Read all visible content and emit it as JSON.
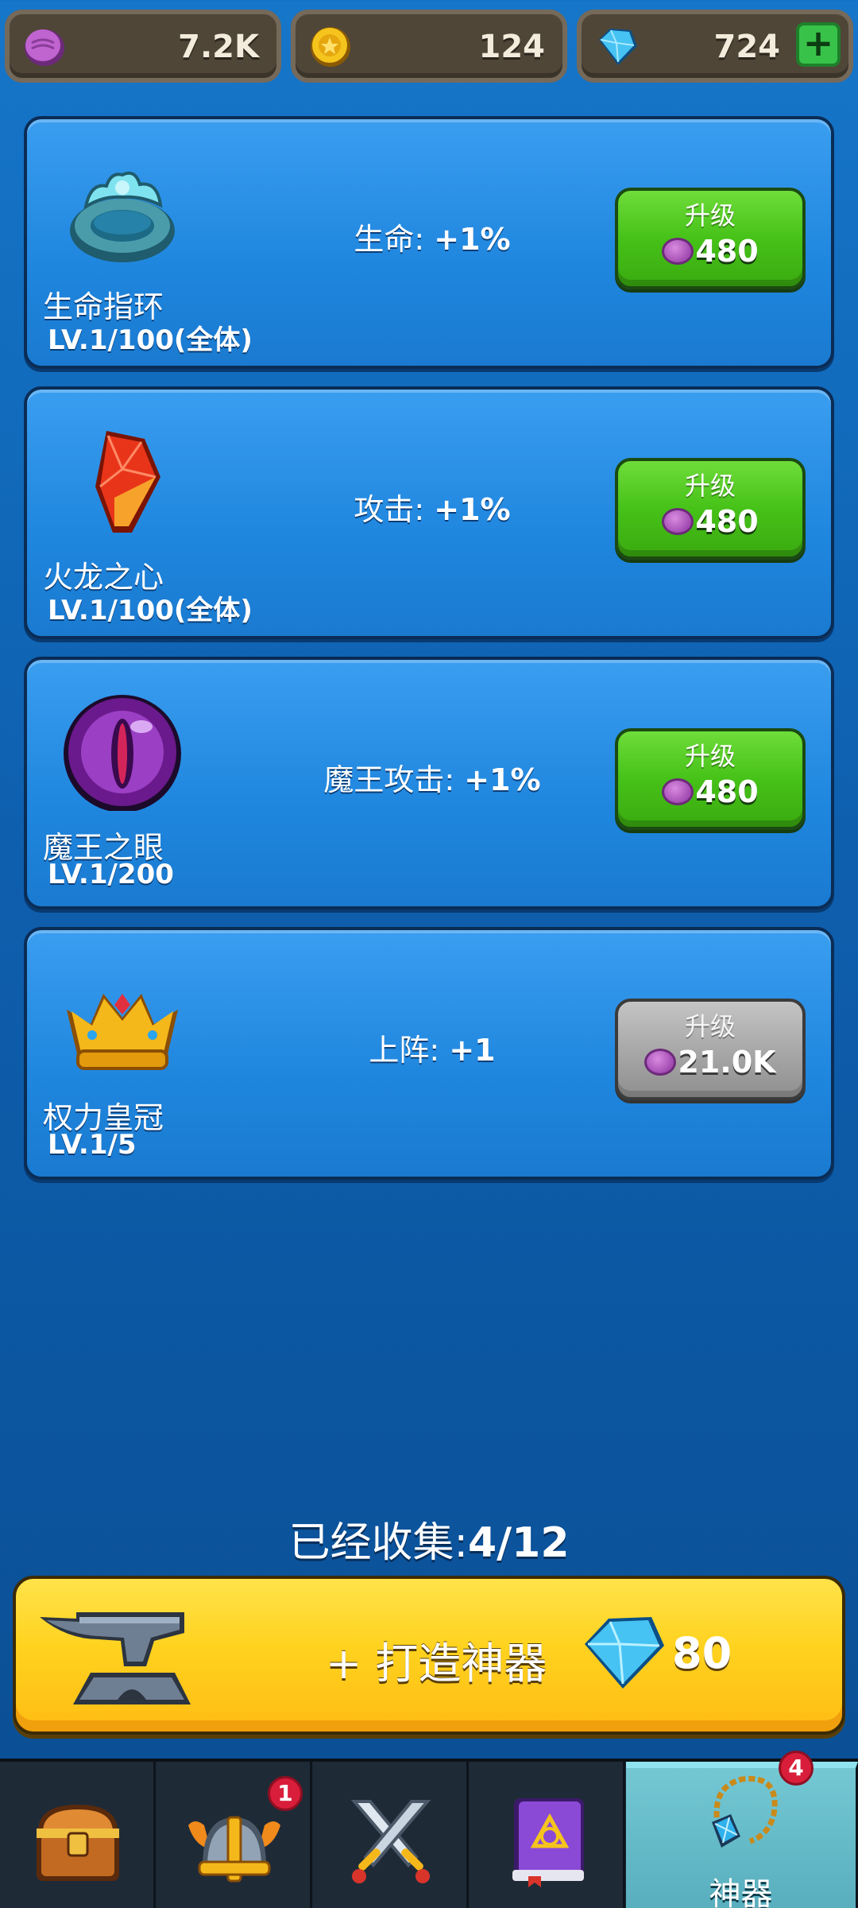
{
  "currencies": {
    "essence": {
      "icon": "purple-essence-icon",
      "value": "7.2K"
    },
    "gold": {
      "icon": "gold-coin-icon",
      "value": "124"
    },
    "gems": {
      "icon": "blue-gem-icon",
      "value": "724",
      "add_label": "+"
    }
  },
  "artifacts": [
    {
      "icon": "life-ring-icon",
      "name": "生命指环",
      "level": "LV.1/100(全体)",
      "effect_label": "生命:",
      "effect_value": "+1%",
      "upgrade_label": "升级",
      "cost": "480",
      "enabled": true
    },
    {
      "icon": "dragon-heart-icon",
      "name": "火龙之心",
      "level": "LV.1/100(全体)",
      "effect_label": "攻击:",
      "effect_value": "+1%",
      "upgrade_label": "升级",
      "cost": "480",
      "enabled": true
    },
    {
      "icon": "demon-eye-icon",
      "name": "魔王之眼",
      "level": "LV.1/200",
      "effect_label": "魔王攻击:",
      "effect_value": "+1%",
      "upgrade_label": "升级",
      "cost": "480",
      "enabled": true
    },
    {
      "icon": "crown-icon",
      "name": "权力皇冠",
      "level": "LV.1/5",
      "effect_label": "上阵:",
      "effect_value": "+1",
      "upgrade_label": "升级",
      "cost": "21.0K",
      "enabled": false
    }
  ],
  "collection": {
    "label": "已经收集:",
    "value": "4/12"
  },
  "forge": {
    "label": "+ 打造神器",
    "cost": "80",
    "icon": "anvil-icon",
    "cost_icon": "blue-gem-icon"
  },
  "nav": {
    "tabs": [
      {
        "icon": "treasure-chest-icon",
        "label": "",
        "badge": ""
      },
      {
        "icon": "viking-helmet-icon",
        "label": "",
        "badge": "1"
      },
      {
        "icon": "crossed-swords-icon",
        "label": "",
        "badge": ""
      },
      {
        "icon": "spell-book-icon",
        "label": "",
        "badge": ""
      },
      {
        "icon": "amulet-icon",
        "label": "神器",
        "badge": "4"
      }
    ]
  },
  "colors": {
    "upgrade_green": "#46c218",
    "upgrade_disabled": "#a6a6a6",
    "forge_yellow": "#ffd21e",
    "badge_red": "#d81e3a",
    "active_tab": "#58aebd"
  }
}
